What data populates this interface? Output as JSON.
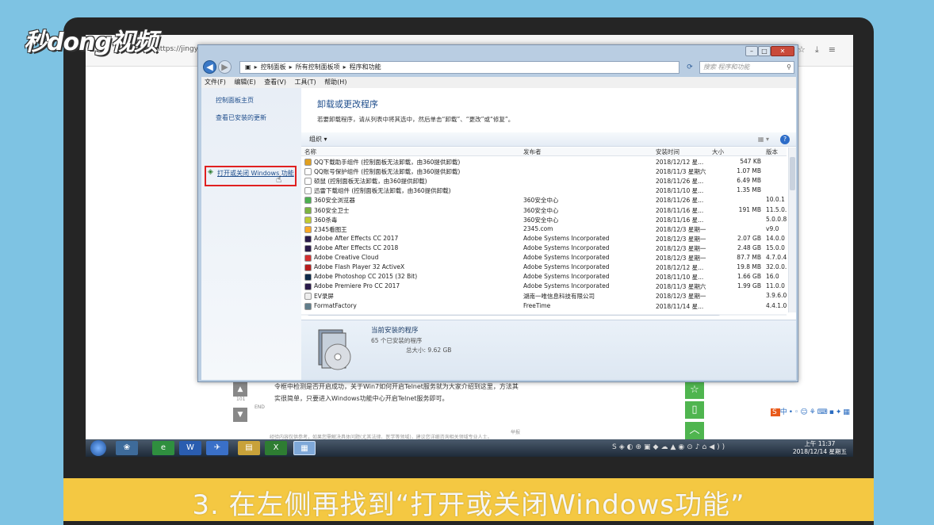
{
  "overlay": {
    "logo": "秒dong视频",
    "caption": "3. 在左侧再找到“打开或关闭Windows功能”"
  },
  "browser": {
    "url": "https://jingya"
  },
  "background_page": {
    "line1": "令框中检测是否开启成功，关于Win7如何开启Telnet服务就为大家介绍到这里，方法其",
    "line2": "实很简单，只要进入Windows功能中心开启Telnet服务即可。",
    "end_label": "END",
    "vote_count": "101",
    "footer_note": "经验内容仅供参考，如果您需解决具体问题(尤其法律、医学等领域)，建议您详细咨询相关领域专业人士。",
    "report": "举报"
  },
  "window": {
    "breadcrumb": [
      "控制面板",
      "所有控制面板项",
      "程序和功能"
    ],
    "search_placeholder": "搜索 程序和功能",
    "menu": [
      "文件(F)",
      "编辑(E)",
      "查看(V)",
      "工具(T)",
      "帮助(H)"
    ],
    "left": {
      "home": "控制面板主页",
      "updates": "查看已安装的更新",
      "features": "打开或关闭 Windows 功能"
    },
    "heading": "卸载或更改程序",
    "subtext": "若要卸载程序，请从列表中将其选中，然后单击“卸载”、“更改”或“修复”。",
    "organize": "组织 ▾",
    "columns": {
      "name": "名称",
      "publisher": "发布者",
      "date": "安装时间",
      "size": "大小",
      "version": "版本"
    },
    "programs": [
      {
        "name": "QQ下载助手组件 (控制面板无法卸载，由360提供卸载)",
        "publisher": "",
        "date": "2018/12/12 星...",
        "size": "547 KB",
        "version": "",
        "icon": "#e0a020"
      },
      {
        "name": "QQ账号保护组件 (控制面板无法卸载，由360提供卸载)",
        "publisher": "",
        "date": "2018/11/3 星期六",
        "size": "1.07 MB",
        "version": "",
        "icon": "#ffffff"
      },
      {
        "name": "硕鼠 (控制面板无法卸载，由360提供卸载)",
        "publisher": "",
        "date": "2018/11/26 星...",
        "size": "6.49 MB",
        "version": "",
        "icon": "#ffffff"
      },
      {
        "name": "迅雷下载组件 (控制面板无法卸载，由360提供卸载)",
        "publisher": "",
        "date": "2018/11/10 星...",
        "size": "1.35 MB",
        "version": "",
        "icon": "#ffffff"
      },
      {
        "name": "360安全浏览器",
        "publisher": "360安全中心",
        "date": "2018/11/26 星...",
        "size": "",
        "version": "10.0.1",
        "icon": "#4caf50"
      },
      {
        "name": "360安全卫士",
        "publisher": "360安全中心",
        "date": "2018/11/16 星...",
        "size": "191 MB",
        "version": "11.5.0.",
        "icon": "#7cb342"
      },
      {
        "name": "360杀毒",
        "publisher": "360安全中心",
        "date": "2018/11/16 星...",
        "size": "",
        "version": "5.0.0.8",
        "icon": "#c0ca33"
      },
      {
        "name": "2345看图王",
        "publisher": "2345.com",
        "date": "2018/12/3 星期一",
        "size": "",
        "version": "v9.0",
        "icon": "#f9a825"
      },
      {
        "name": "Adobe After Effects CC 2017",
        "publisher": "Adobe Systems Incorporated",
        "date": "2018/12/3 星期一",
        "size": "2.07 GB",
        "version": "14.0.0",
        "icon": "#2a1a4a"
      },
      {
        "name": "Adobe After Effects CC 2018",
        "publisher": "Adobe Systems Incorporated",
        "date": "2018/12/3 星期一",
        "size": "2.48 GB",
        "version": "15.0.0",
        "icon": "#2a1a4a"
      },
      {
        "name": "Adobe Creative Cloud",
        "publisher": "Adobe Systems Incorporated",
        "date": "2018/12/3 星期一",
        "size": "87.7 MB",
        "version": "4.7.0.4",
        "icon": "#d32f2f"
      },
      {
        "name": "Adobe Flash Player 32 ActiveX",
        "publisher": "Adobe Systems Incorporated",
        "date": "2018/12/12 星...",
        "size": "19.8 MB",
        "version": "32.0.0.",
        "icon": "#b71c1c"
      },
      {
        "name": "Adobe Photoshop CC 2015 (32 Bit)",
        "publisher": "Adobe Systems Incorporated",
        "date": "2018/11/10 星...",
        "size": "1.66 GB",
        "version": "16.0",
        "icon": "#0d2a4a"
      },
      {
        "name": "Adobe Premiere Pro CC 2017",
        "publisher": "Adobe Systems Incorporated",
        "date": "2018/11/3 星期六",
        "size": "1.99 GB",
        "version": "11.0.0",
        "icon": "#2a1a4a"
      },
      {
        "name": "EV录屏",
        "publisher": "湖南一唯信息科技有限公司",
        "date": "2018/12/3 星期一",
        "size": "",
        "version": "3.9.6.0",
        "icon": "#eeeeee"
      },
      {
        "name": "FormatFactory",
        "publisher": "FreeTime",
        "date": "2018/11/14 星...",
        "size": "",
        "version": "4.4.1.0",
        "icon": "#607d8b"
      }
    ],
    "details": {
      "title": "当前安装的程序",
      "count": "65 个已安装的程序",
      "total": "总大小: 9.62 GB"
    }
  },
  "taskbar": {
    "time": "上午 11:37",
    "date": "2018/12/14 星期五"
  },
  "colors": {
    "background": "#7ec3e3",
    "caption_bar": "#f4c842",
    "highlight": "#e02020",
    "link": "#1f4e8c"
  }
}
